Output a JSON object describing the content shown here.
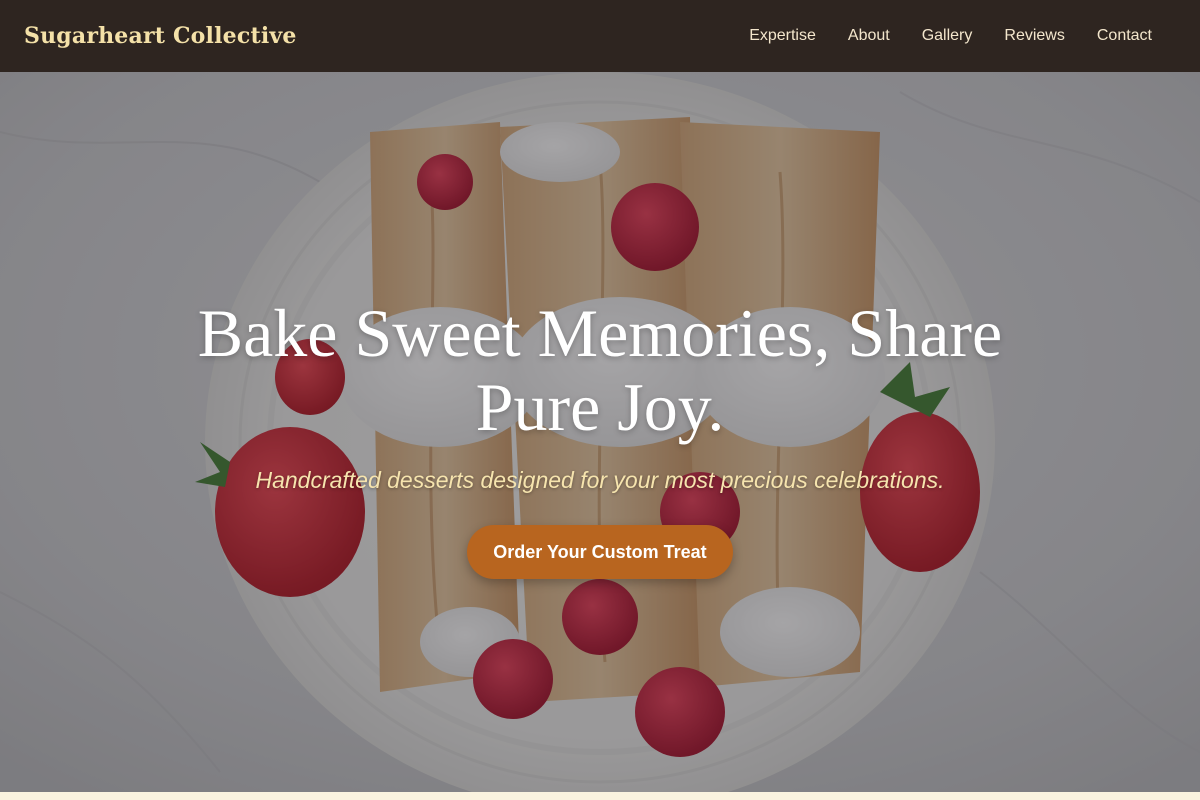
{
  "nav": {
    "brand": "Sugarheart Collective",
    "links": [
      "Expertise",
      "About",
      "Gallery",
      "Reviews",
      "Contact"
    ]
  },
  "hero": {
    "title": "Bake Sweet Memories, Share Pure Joy.",
    "subtitle": "Handcrafted desserts designed for your most precious celebrations.",
    "cta_label": "Order Your Custom Treat",
    "background_image": "crepes-with-strawberries-raspberries-whipped-cream-plate"
  },
  "colors": {
    "nav_background": "#2e2520",
    "brand_text": "#f4e1a8",
    "nav_text": "#f3e6cc",
    "hero_title": "#ffffff",
    "hero_subtitle": "#f6e4ae",
    "cta_background": "#b8651f",
    "cta_text": "#ffffff"
  }
}
